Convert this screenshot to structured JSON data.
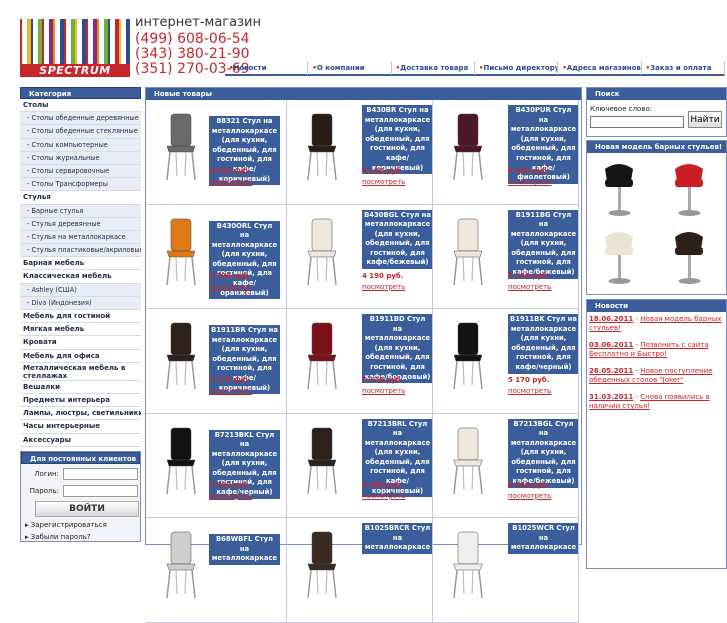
{
  "header": {
    "logo_text": "SPECTRUM",
    "shop_label": "интернет-магазин",
    "phones": [
      "(499) 608-06-54",
      "(343) 380-21-90",
      "(351) 270-03-69"
    ],
    "nav": [
      "Новости",
      "О компании",
      "Доставка товара",
      "Письмо директору",
      "Адреса магазинов",
      "Заказ и оплата"
    ]
  },
  "sidebar": {
    "title": "Категория",
    "items": [
      {
        "label": "Столы",
        "kind": "main"
      },
      {
        "label": "- Столы обеденные деревянные",
        "kind": "sub"
      },
      {
        "label": "- Столы обеденные стеклянные",
        "kind": "sub"
      },
      {
        "label": "- Столы компьютерные",
        "kind": "sub"
      },
      {
        "label": "- Столы журнальные",
        "kind": "sub"
      },
      {
        "label": "- Столы сервировочные",
        "kind": "sub"
      },
      {
        "label": "- Столы Трансформеры",
        "kind": "sub"
      },
      {
        "label": "Стулья",
        "kind": "main"
      },
      {
        "label": "- Барные стулья",
        "kind": "sub"
      },
      {
        "label": "- Стулья деревянные",
        "kind": "sub"
      },
      {
        "label": "- Стулья на металлокаркасе",
        "kind": "sub"
      },
      {
        "label": "- Стулья пластиковые/акриловые",
        "kind": "sub"
      },
      {
        "label": "Барная мебель",
        "kind": "main"
      },
      {
        "label": "Классическая мебель",
        "kind": "main"
      },
      {
        "label": "- Ashley (США)",
        "kind": "sub"
      },
      {
        "label": "- Diva (Индонезия)",
        "kind": "sub"
      },
      {
        "label": "Мебель для гостиной",
        "kind": "main"
      },
      {
        "label": "Мягкая мебель",
        "kind": "main"
      },
      {
        "label": "Кровати",
        "kind": "main"
      },
      {
        "label": "Мебель для офиса",
        "kind": "main"
      },
      {
        "label": "Металлическая мебель в стеллажах",
        "kind": "main tall"
      },
      {
        "label": "Вешалки",
        "kind": "main"
      },
      {
        "label": "Предметы интерьера",
        "kind": "main"
      },
      {
        "label": "Лампы, люстры, светильники",
        "kind": "main"
      },
      {
        "label": "Часы интерьерные",
        "kind": "main"
      },
      {
        "label": "Аксессуары",
        "kind": "main"
      }
    ],
    "login": {
      "title": "Для постоянных клиентов",
      "login_label": "Логин:",
      "password_label": "Пароль:",
      "submit": "ВОЙТИ",
      "register": "Зарегистрироваться",
      "forgot": "Забыли пароль?"
    }
  },
  "main": {
    "title": "Новые товары",
    "products": [
      {
        "desc": "88321 Стул на металлокаркасе (для кухни, обеденный, для гостиной, для кафе/коричневый)",
        "price": "5 950 руб.",
        "color": "#6a6a6a"
      },
      {
        "desc": "B430BR Стул на металлокаркасе (для кухни, обеденный, для гостиной, для кафе/коричневый)",
        "price": "4 190 руб.",
        "color": "#2a1d17"
      },
      {
        "desc": "B430PUR Стул на металлокаркасе (для кухни, обеденный, для гостиной, для кафе/фиолетовый)",
        "price": "4 190 руб.",
        "color": "#4e1728"
      },
      {
        "desc": "B430ORL Стул на металлокаркасе (для кухни, обеденный, для гостиной, для кафе/оранжевый)",
        "price": "4 190 руб.",
        "color": "#e07a18"
      },
      {
        "desc": "B430BGL Стул на металлокаркасе (для кухни, обеденный, для гостиной, для кафе/бежевый)",
        "price": "4 190 руб.",
        "color": "#efe9dd"
      },
      {
        "desc": "B1911BG Стул на металлокаркасе (для кухни, обеденный, для гостиной, для кафе/бежевый)",
        "price": "4 190 руб.",
        "color": "#efe9dd"
      },
      {
        "desc": "B1911BR Стул на металлокаркасе (для кухни, обеденный, для гостиной, для кафе/коричневый)",
        "price": "5 170 руб.",
        "color": "#2e201a"
      },
      {
        "desc": "B1911BD Стул на металлокаркасе (для кухни, обеденный, для гостиной, для кафе/бордовый)",
        "price": "5 170 руб.",
        "color": "#7c1018"
      },
      {
        "desc": "B1911BK Стул на металлокаркасе (для кухни, обеденный, для гостиной, для кафе/черный)",
        "price": "5 170 руб.",
        "color": "#121212"
      },
      {
        "desc": "B7213BKL Стул на металлокаркасе (для кухни, обеденный, для гостиной, для кафе/черный)",
        "price": "4 560 руб.",
        "color": "#121212"
      },
      {
        "desc": "B7213BRL Стул на металлокаркасе (для кухни, обеденный, для гостиной, для кафе/коричневый)",
        "price": "4 560 руб.",
        "color": "#2e201a"
      },
      {
        "desc": "B7213BGL Стул на металлокаркасе (для кухни, обеденный, для гостиной, для кафе/бежевый)",
        "price": "4 560 руб.",
        "color": "#efe9dd"
      },
      {
        "desc": "B68WBFL Стул на металлокаркасе",
        "price": "",
        "color": "#cfcfcf"
      },
      {
        "desc": "B1025BRCR Стул на металлокаркасе",
        "price": "",
        "color": "#3a2a22"
      },
      {
        "desc": "B1025WCR Стул на металлокаркасе",
        "price": "",
        "color": "#efefef"
      }
    ],
    "more_label": "посмотреть"
  },
  "right": {
    "search_title": "Поиск",
    "search_label": "Ключевое слово:",
    "search_button": "Найти",
    "promo_title": "Новая модель барных стульев!",
    "news_title": "Новости",
    "news": [
      {
        "date": "18.06.2011",
        "text": "Новая модель барных стульев!"
      },
      {
        "date": "03.06.2011",
        "text": "Позвонить с сайта Бесплатно и Быстро!"
      },
      {
        "date": "26.05.2011",
        "text": "Новое поступление обеденных столов \"Joker\""
      },
      {
        "date": "31.03.2011",
        "text": "Снова появились в наличии стулья!"
      }
    ]
  }
}
